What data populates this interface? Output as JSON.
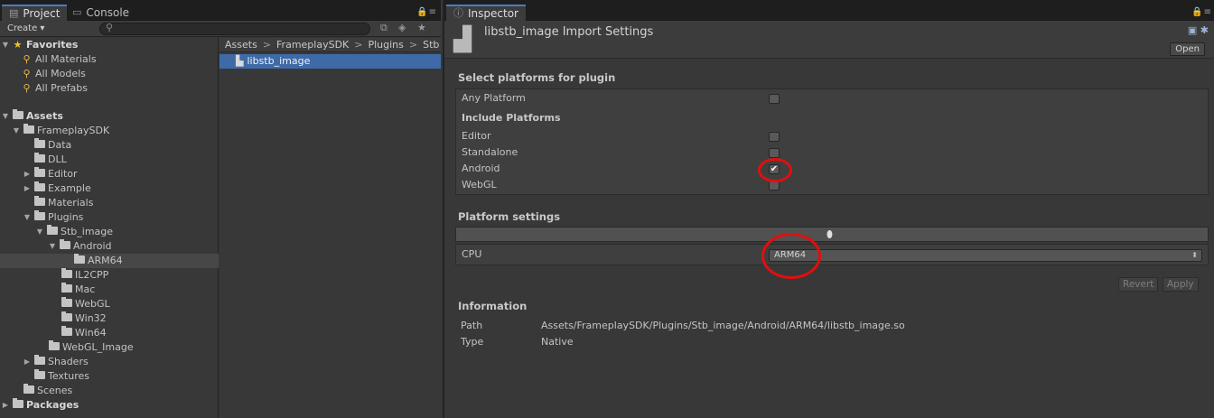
{
  "project": {
    "tabs": [
      {
        "label": "Project",
        "icon": "folder-icon"
      },
      {
        "label": "Console",
        "icon": "console-icon"
      }
    ],
    "create_label": "Create ▾",
    "favorites": {
      "label": "Favorites",
      "items": [
        "All Materials",
        "All Models",
        "All Prefabs"
      ]
    },
    "tree": {
      "assets": "Assets",
      "frameplay": "FrameplaySDK",
      "data": "Data",
      "dll": "DLL",
      "editor": "Editor",
      "example": "Example",
      "materials": "Materials",
      "plugins": "Plugins",
      "stb": "Stb_image",
      "android": "Android",
      "arm64": "ARM64",
      "il2cpp": "IL2CPP",
      "mac": "Mac",
      "webgl": "WebGL",
      "win32": "Win32",
      "win64": "Win64",
      "webgl_image": "WebGL_Image",
      "shaders": "Shaders",
      "textures": "Textures",
      "scenes": "Scenes",
      "packages": "Packages"
    },
    "breadcrumb": [
      "Assets",
      "FrameplaySDK",
      "Plugins",
      "Stb"
    ],
    "selected_file": "libstb_image"
  },
  "inspector": {
    "tab_label": "Inspector",
    "title": "libstb_image Import Settings",
    "open_label": "Open",
    "select_platforms_title": "Select platforms for plugin",
    "any_platform": "Any Platform",
    "include_platforms": "Include Platforms",
    "platforms": [
      {
        "name": "Editor",
        "checked": false
      },
      {
        "name": "Standalone",
        "checked": false
      },
      {
        "name": "Android",
        "checked": true
      },
      {
        "name": "WebGL",
        "checked": false
      }
    ],
    "platform_settings_title": "Platform settings",
    "cpu_label": "CPU",
    "cpu_value": "ARM64",
    "revert_label": "Revert",
    "apply_label": "Apply",
    "information_title": "Information",
    "path_label": "Path",
    "path_value": "Assets/FrameplaySDK/Plugins/Stb_image/Android/ARM64/libstb_image.so",
    "type_label": "Type",
    "type_value": "Native"
  },
  "colors": {
    "background": "#383838",
    "selection": "#3e6aa8",
    "annotation_ring": "#e30e0e"
  }
}
